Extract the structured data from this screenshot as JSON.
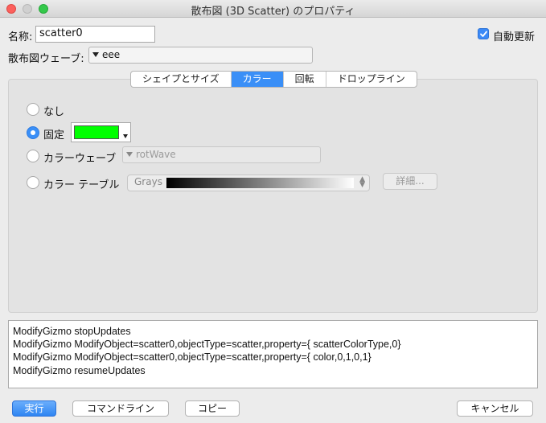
{
  "window": {
    "title": "散布図 (3D Scatter) のプロパティ"
  },
  "name_field": {
    "label": "名称:",
    "value": "scatter0"
  },
  "auto_update": {
    "label": "自動更新",
    "checked": true
  },
  "scatter_wave": {
    "label": "散布図ウェーブ:",
    "value": "eee"
  },
  "tabs": [
    {
      "label": "シェイプとサイズ",
      "active": false
    },
    {
      "label": "カラー",
      "active": true
    },
    {
      "label": "回転",
      "active": false
    },
    {
      "label": "ドロップライン",
      "active": false
    }
  ],
  "color_options": {
    "none_label": "なし",
    "fixed_label": "固定",
    "fixed_color": "#00ff00",
    "wave_label": "カラーウェーブ",
    "wave_value": "rotWave",
    "table_label": "カラー テーブル",
    "table_value": "Grays",
    "details_button": "詳細...",
    "selected": "fixed"
  },
  "command_lines": [
    "ModifyGizmo stopUpdates",
    "ModifyGizmo ModifyObject=scatter0,objectType=scatter,property={ scatterColorType,0}",
    "ModifyGizmo ModifyObject=scatter0,objectType=scatter,property={ color,0,1,0,1}",
    "ModifyGizmo resumeUpdates"
  ],
  "buttons": {
    "execute": "実行",
    "command_line": "コマンドライン",
    "copy": "コピー",
    "cancel": "キャンセル"
  },
  "colors": {
    "accent": "#3a8ff7"
  }
}
